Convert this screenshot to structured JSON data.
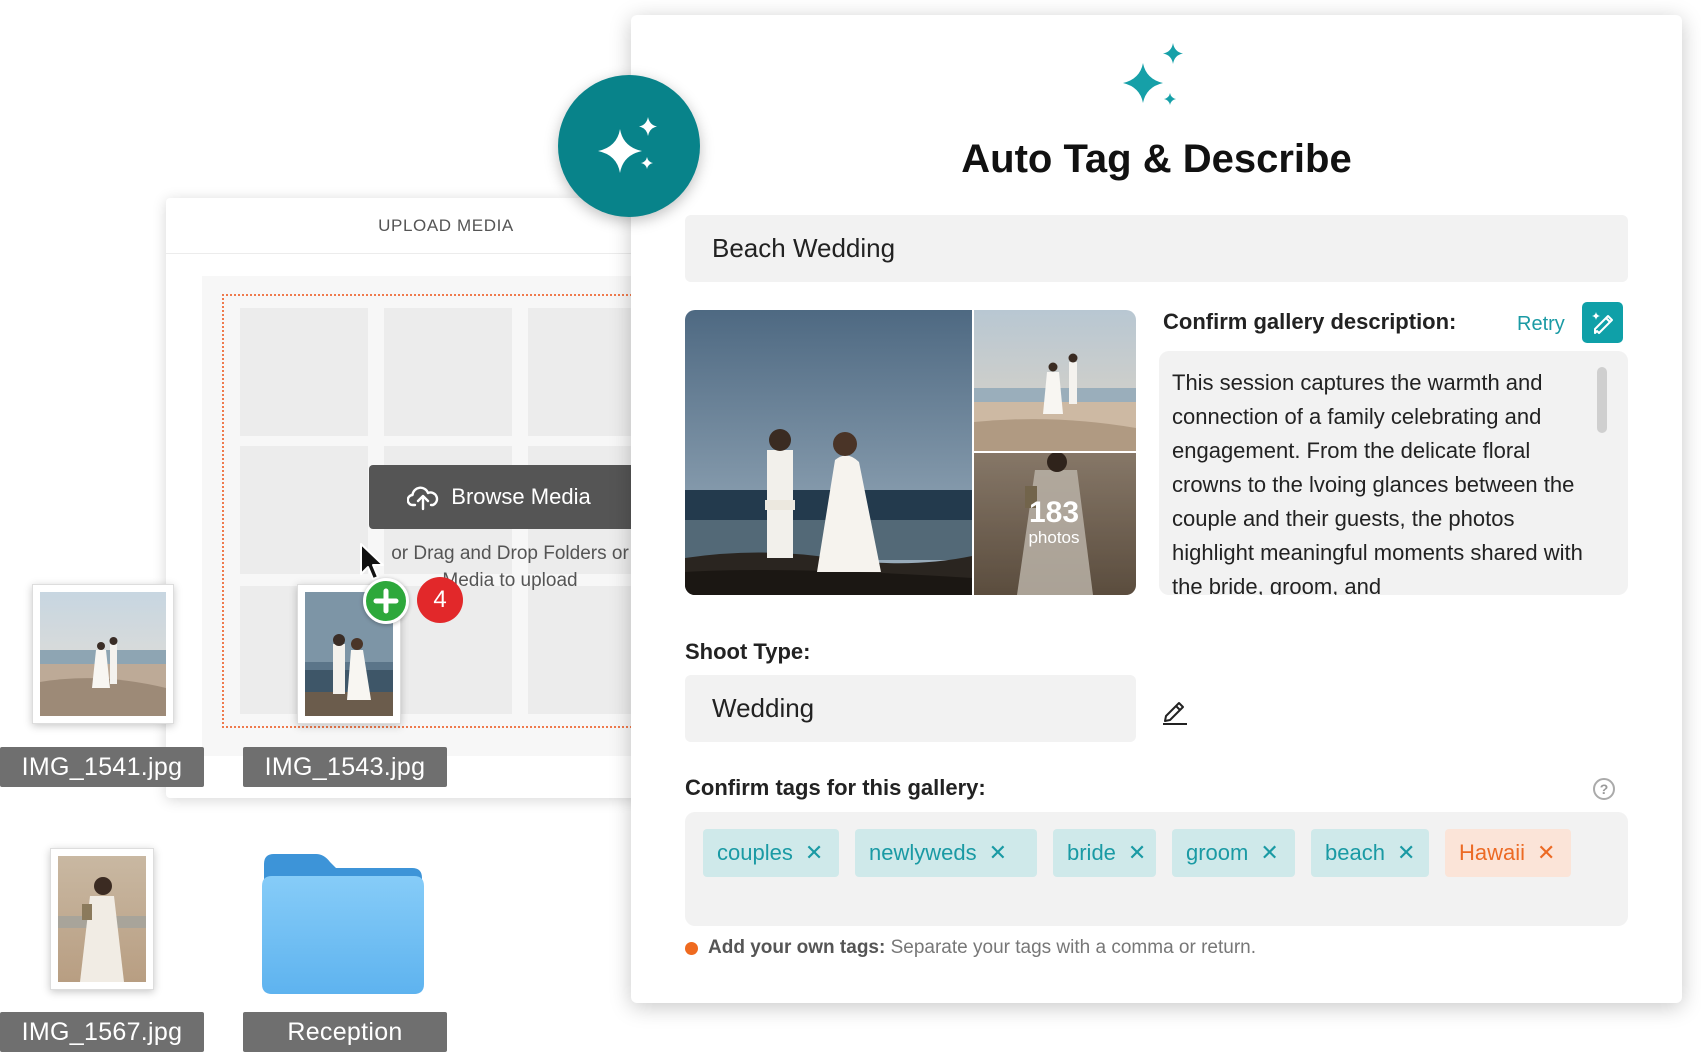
{
  "upload": {
    "header": "UPLOAD MEDIA",
    "browse_label": "Browse Media",
    "drag_text": "or Drag and Drop Folders or Media to upload",
    "drag_count": "4"
  },
  "files": [
    {
      "name": "IMG_1541.jpg"
    },
    {
      "name": "IMG_1543.jpg"
    },
    {
      "name": "IMG_1567.jpg"
    },
    {
      "name": "Reception"
    }
  ],
  "panel": {
    "title": "Auto Tag & Describe",
    "gallery_title": "Beach Wedding",
    "photo_count": "183",
    "photo_count_label": "photos",
    "description_label": "Confirm gallery description:",
    "retry_label": "Retry",
    "description": "This session captures the warmth and connection of a family celebrating and engagement. From the delicate floral crowns to the lvoing glances between the couple and their guests, the photos highlight meaningful moments shared with the bride, groom, and",
    "shoot_type_label": "Shoot Type:",
    "shoot_type": "Wedding",
    "tags_label": "Confirm tags for this gallery:",
    "tags": [
      {
        "label": "couples",
        "remove": "✕",
        "style": "teal"
      },
      {
        "label": "newlyweds",
        "remove": "✕",
        "style": "teal"
      },
      {
        "label": "bride",
        "remove": "✕",
        "style": "teal"
      },
      {
        "label": "groom",
        "remove": "✕",
        "style": "teal"
      },
      {
        "label": "beach",
        "remove": "✕",
        "style": "teal"
      },
      {
        "label": "Hawaii",
        "remove": "✕",
        "style": "orange"
      }
    ],
    "hint_bold": "Add your own tags:",
    "hint_text": "Separate your tags with a comma or return.",
    "help_glyph": "?"
  },
  "colors": {
    "accent_teal": "#08838a",
    "tag_teal": "#1a9aa4",
    "tag_orange": "#ec6a24",
    "drop_border": "#ef7a4d",
    "add_green": "#2da83b",
    "badge_red": "#e2282a"
  },
  "icons": {
    "sparkle": "sparkle-icon",
    "upload_cloud": "cloud-upload-icon",
    "pencil": "pencil-icon",
    "help": "help-circle-icon",
    "folder": "folder-icon",
    "cursor": "cursor-arrow-icon"
  }
}
